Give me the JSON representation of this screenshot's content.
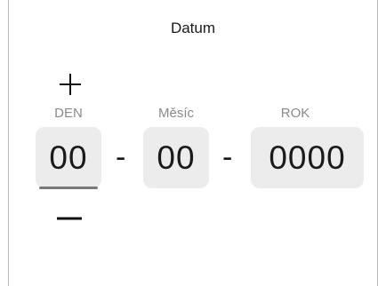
{
  "dialog": {
    "title": "Datum"
  },
  "fields": {
    "day": {
      "label": "DEN",
      "value": "00"
    },
    "month": {
      "label": "Měsíc",
      "value": "00"
    },
    "year": {
      "label": "ROK",
      "value": "0000"
    }
  },
  "separators": {
    "first": "-",
    "second": "-"
  },
  "steppers": {
    "increment_icon": "plus-icon",
    "decrement_icon": "minus-icon"
  }
}
